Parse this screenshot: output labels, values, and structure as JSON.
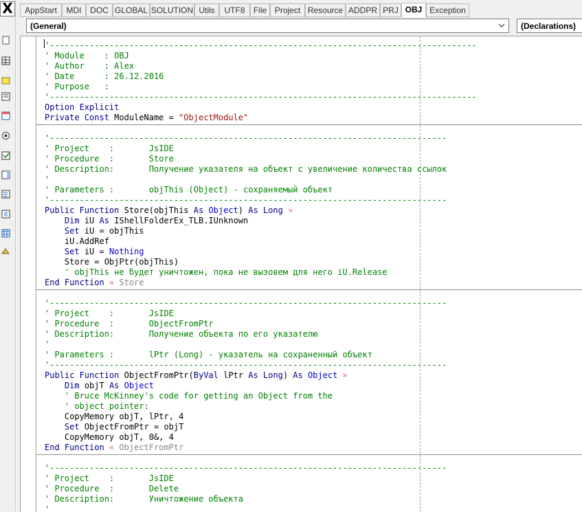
{
  "tabs": [
    "AppStart",
    "MDI",
    "DOC",
    "GLOBAL",
    "SOLUTION",
    "Utils",
    "UTF8",
    "File",
    "Project",
    "Resource",
    "ADDPR",
    "PRJ",
    "OBJ",
    "Exception"
  ],
  "active_tab": "OBJ",
  "object_combo": "(General)",
  "procedure_combo": "(Declarations)",
  "close_glyph": "X",
  "code_lines": [
    [
      [
        "c",
        "'--------------------------------------------------------------------------------------"
      ]
    ],
    [
      [
        "c",
        "' Module    : OBJ"
      ]
    ],
    [
      [
        "c",
        "' Author    : Alex"
      ]
    ],
    [
      [
        "c",
        "' Date      : 26.12.2016"
      ]
    ],
    [
      [
        "c",
        "' Purpose   :"
      ]
    ],
    [
      [
        "c",
        "'--------------------------------------------------------------------------------------"
      ]
    ],
    [
      [
        "k",
        "Option Explicit"
      ]
    ],
    [
      [
        "k",
        "Private Const "
      ],
      [
        "t",
        "ModuleName = "
      ],
      [
        "s",
        "\"ObjectModule\""
      ]
    ],
    "SEP",
    [
      [
        "c",
        "'--------------------------------------------------------------------------------"
      ]
    ],
    [
      [
        "c",
        "' Project    :       JsIDE"
      ]
    ],
    [
      [
        "c",
        "' Procedure  :       Store"
      ]
    ],
    [
      [
        "c",
        "' Description:       Получение указателя на объект с увеличение количества ссылок"
      ]
    ],
    [
      [
        "c",
        "'"
      ]
    ],
    [
      [
        "c",
        "' Parameters :       objThis (Object) - сохраняемый объект"
      ]
    ],
    [
      [
        "c",
        "'--------------------------------------------------------------------------------"
      ]
    ],
    [
      [
        "k",
        "Public Function "
      ],
      [
        "t",
        "Store(objThis "
      ],
      [
        "k",
        "As "
      ],
      [
        "k2",
        "Object"
      ],
      [
        "t",
        ") "
      ],
      [
        "k",
        "As Long "
      ],
      [
        "a",
        "»"
      ]
    ],
    [
      [
        "t",
        "    "
      ],
      [
        "k",
        "Dim "
      ],
      [
        "t",
        "iU "
      ],
      [
        "k",
        "As "
      ],
      [
        "t",
        "IShellFolderEx_TLB.IUnknown"
      ]
    ],
    [
      [
        "t",
        "    "
      ],
      [
        "k",
        "Set "
      ],
      [
        "t",
        "iU = objThis"
      ]
    ],
    [
      [
        "t",
        "    iU.AddRef"
      ]
    ],
    [
      [
        "t",
        "    "
      ],
      [
        "k",
        "Set "
      ],
      [
        "t",
        "iU = "
      ],
      [
        "k2",
        "Nothing"
      ]
    ],
    [
      [
        "t",
        "    Store = ObjPtr(objThis)"
      ]
    ],
    [
      [
        "c",
        "    ' objThis не будет уничтожен, пока не вызовем для него iU.Release"
      ]
    ],
    [
      [
        "k",
        "End Function "
      ],
      [
        "a",
        "« "
      ],
      [
        "g",
        "Store"
      ]
    ],
    "SEP",
    [
      [
        "c",
        "'--------------------------------------------------------------------------------"
      ]
    ],
    [
      [
        "c",
        "' Project    :       JsIDE"
      ]
    ],
    [
      [
        "c",
        "' Procedure  :       ObjectFromPtr"
      ]
    ],
    [
      [
        "c",
        "' Description:       Получение объекта по его указателю"
      ]
    ],
    [
      [
        "c",
        "'"
      ]
    ],
    [
      [
        "c",
        "' Parameters :       lPtr (Long) - указатель на сохраненный объект"
      ]
    ],
    [
      [
        "c",
        "'--------------------------------------------------------------------------------"
      ]
    ],
    [
      [
        "k",
        "Public Function "
      ],
      [
        "t",
        "ObjectFromPtr("
      ],
      [
        "k",
        "ByVal "
      ],
      [
        "t",
        "lPtr "
      ],
      [
        "k",
        "As Long"
      ],
      [
        "t",
        ") "
      ],
      [
        "k",
        "As "
      ],
      [
        "k2",
        "Object "
      ],
      [
        "a",
        "»"
      ]
    ],
    [
      [
        "t",
        "    "
      ],
      [
        "k",
        "Dim "
      ],
      [
        "t",
        "objT "
      ],
      [
        "k",
        "As "
      ],
      [
        "k2",
        "Object"
      ]
    ],
    [
      [
        "c",
        "    ' Bruce McKinney's code for getting an Object from the"
      ]
    ],
    [
      [
        "c",
        "    ' object pointer:"
      ]
    ],
    [
      [
        "t",
        "    CopyMemory objT, lPtr, 4"
      ]
    ],
    [
      [
        "t",
        "    "
      ],
      [
        "k",
        "Set "
      ],
      [
        "t",
        "ObjectFromPtr = objT"
      ]
    ],
    [
      [
        "t",
        "    CopyMemory objT, 0&, 4"
      ]
    ],
    [
      [
        "k",
        "End Function "
      ],
      [
        "a",
        "« "
      ],
      [
        "g",
        "ObjectFromPtr"
      ]
    ],
    "SEP",
    [
      [
        "c",
        "'--------------------------------------------------------------------------------"
      ]
    ],
    [
      [
        "c",
        "' Project    :       JsIDE"
      ]
    ],
    [
      [
        "c",
        "' Procedure  :       Delete"
      ]
    ],
    [
      [
        "c",
        "' Description:       Уничтожение объекта"
      ]
    ],
    [
      [
        "c",
        "'"
      ]
    ]
  ]
}
